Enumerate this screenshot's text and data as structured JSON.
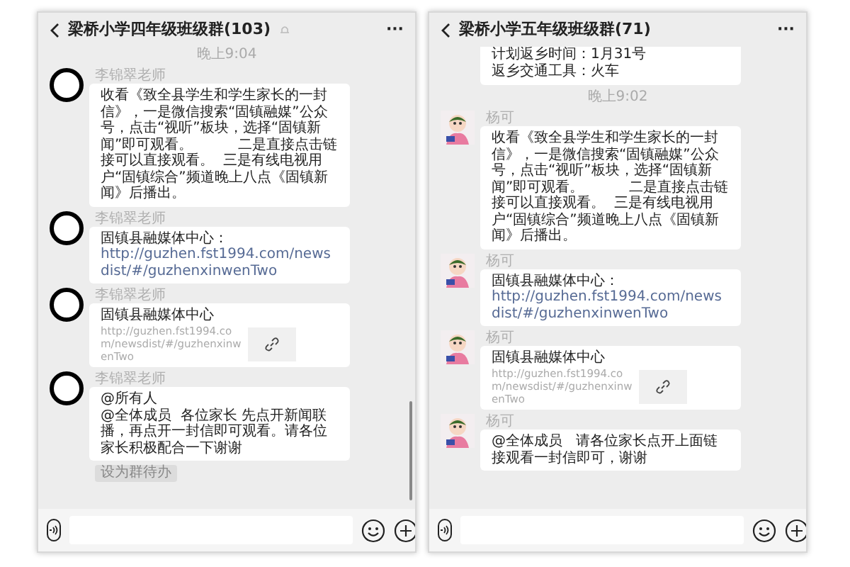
{
  "panels": [
    {
      "title": "梁桥小学四年级班级群(103)",
      "muted": true,
      "avatar": {
        "kind": "badge"
      },
      "scrollbar": true,
      "more": "···",
      "messages": [
        {
          "kind": "time",
          "text": "晚上9:04"
        },
        {
          "kind": "text",
          "sender": "李锦翠老师",
          "text": "收看《致全县学生和学生家长的一封信》，一是微信搜索“固镇融媒”公众号，点击“视听”板块，选择“固镇新闻”即可观看。          二是直接点击链接可以直接观看。  三是有线电视用户“固镇综合”频道晚上八点《固镇新闻》后播出。"
        },
        {
          "kind": "link_text",
          "sender": "李锦翠老师",
          "prefix": "固镇县融媒体中心：",
          "url": "http://guzhen.fst1994.com/newsdist/#/guzhenxinwenTwo"
        },
        {
          "kind": "card",
          "sender": "李锦翠老师",
          "title": "固镇县融媒体中心",
          "url": "http://guzhen.fst1994.com/newsdist/#/guzhenxinwenTwo"
        },
        {
          "kind": "text",
          "sender": "李锦翠老师",
          "text": "@所有人\n@全体成员  各位家长 先点开新闻联播，再点开一封信即可观看。请各位家长积极配合一下谢谢"
        },
        {
          "kind": "tag",
          "text": "设为群待办"
        }
      ]
    },
    {
      "title": "梁桥小学五年级班级群(71)",
      "muted": false,
      "avatar": {
        "kind": "cartoon"
      },
      "scrollbar": false,
      "more": "···",
      "messages": [
        {
          "kind": "fragment",
          "lines": [
            "计划返乡时间：1月31号",
            "返乡交通工具：火车"
          ]
        },
        {
          "kind": "time",
          "text": "晚上9:02"
        },
        {
          "kind": "text",
          "sender": "杨可",
          "text": "收看《致全县学生和学生家长的一封信》，一是微信搜索“固镇融媒”公众号，点击“视听”板块，选择“固镇新闻”即可观看。          二是直接点击链接可以直接观看。  三是有线电视用户“固镇综合”频道晚上八点《固镇新闻》后播出。"
        },
        {
          "kind": "link_text",
          "sender": "杨可",
          "prefix": "固镇县融媒体中心：",
          "url": "http://guzhen.fst1994.com/newsdist/#/guzhenxinwenTwo"
        },
        {
          "kind": "card",
          "sender": "杨可",
          "title": "固镇县融媒体中心",
          "url": "http://guzhen.fst1994.com/newsdist/#/guzhenxinwenTwo"
        },
        {
          "kind": "text",
          "sender": "杨可",
          "text": "@全体成员   请各位家长点开上面链接观看一封信即可，谢谢"
        }
      ]
    }
  ]
}
